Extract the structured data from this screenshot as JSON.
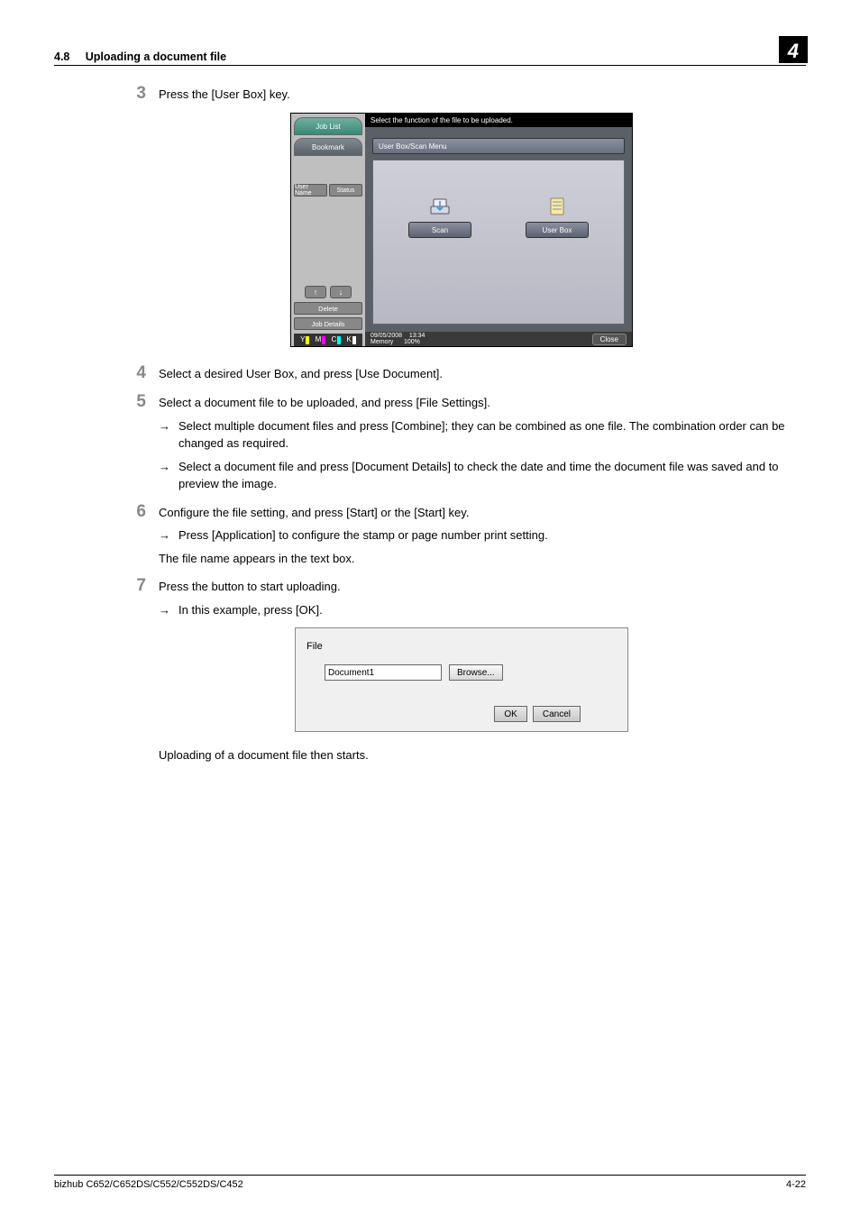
{
  "header": {
    "section_num": "4.8",
    "section_title": "Uploading a document file",
    "chapter_num": "4"
  },
  "steps": {
    "s3": {
      "num": "3",
      "text": "Press the [User Box] key."
    },
    "s4": {
      "num": "4",
      "text": "Select a desired User Box, and press [Use Document]."
    },
    "s5": {
      "num": "5",
      "text": "Select a document file to be uploaded, and press [File Settings].",
      "sub1": "Select multiple document files and press [Combine]; they can be combined as one file. The combination order can be changed as required.",
      "sub2": "Select a document file and press [Document Details] to check the date and time the document file was saved and to preview the image."
    },
    "s6": {
      "num": "6",
      "text": "Configure the file setting, and press [Start] or the [Start] key.",
      "sub1": "Press [Application] to configure the stamp or page number print setting.",
      "plain": "The file name appears in the text box."
    },
    "s7": {
      "num": "7",
      "text": "Press the button to start uploading.",
      "sub1": "In this example, press [OK].",
      "after": "Uploading of a document file then starts."
    }
  },
  "device_ui": {
    "joblist": "Job List",
    "bookmark": "Bookmark",
    "user_name": "User Name",
    "status": "Status",
    "delete": "Delete",
    "job_details": "Job Details",
    "prompt": "Select the function of the file to be uploaded.",
    "menu": "User Box/Scan Menu",
    "scan": "Scan",
    "userbox": "User Box",
    "date": "09/05/2008",
    "time": "13:34",
    "memory": "Memory",
    "mem_pct": "100%",
    "close": "Close",
    "ymck": {
      "y": "Y",
      "m": "M",
      "c": "C",
      "k": "K"
    }
  },
  "file_dialog": {
    "label": "File",
    "value": "Document1",
    "browse": "Browse...",
    "ok": "OK",
    "cancel": "Cancel"
  },
  "footer": {
    "model": "bizhub C652/C652DS/C552/C552DS/C452",
    "page": "4-22"
  },
  "glyph": {
    "arrow": "→",
    "up": "↑",
    "down": "↓"
  }
}
